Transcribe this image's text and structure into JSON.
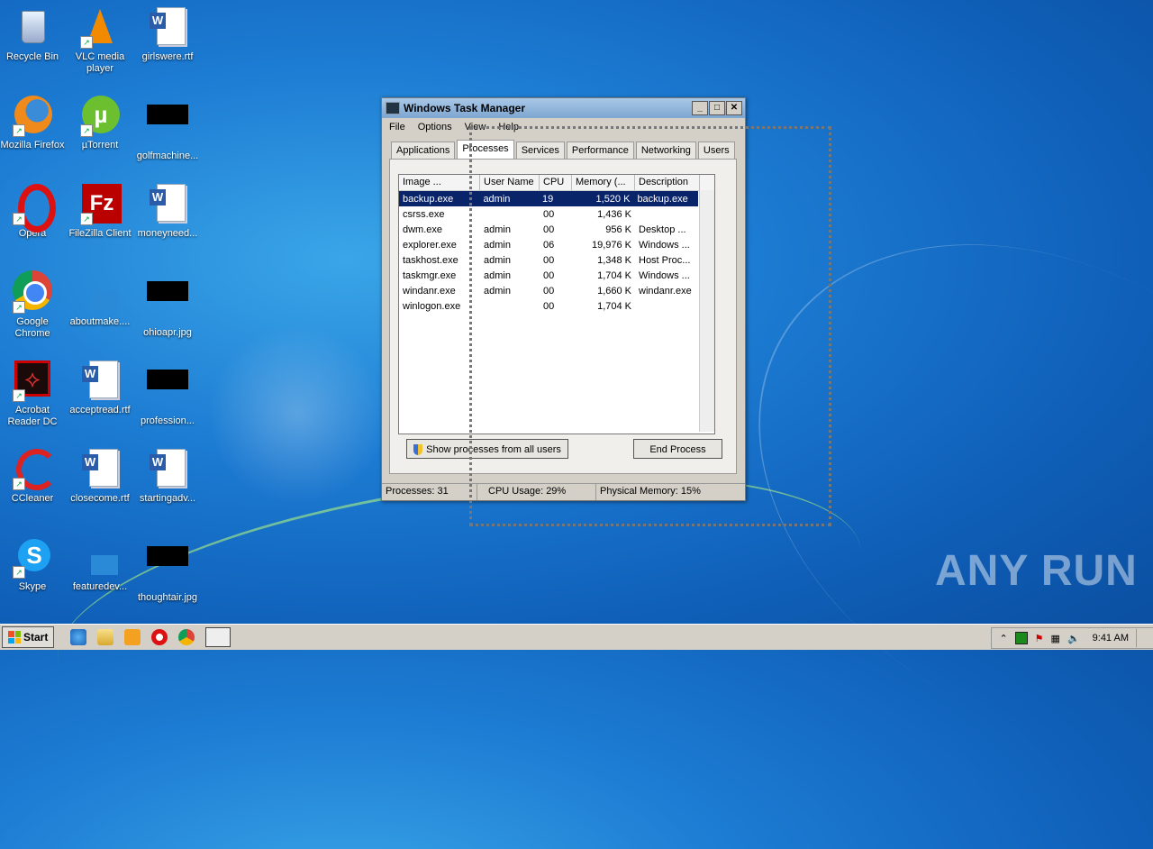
{
  "desktop": {
    "icons": [
      {
        "label": "Recycle Bin"
      },
      {
        "label": "VLC media player"
      },
      {
        "label": "girlswere.rtf"
      },
      {
        "label": "Mozilla Firefox"
      },
      {
        "label": "µTorrent"
      },
      {
        "label": "golfmachine..."
      },
      {
        "label": "Opera"
      },
      {
        "label": "FileZilla Client"
      },
      {
        "label": "moneyneed..."
      },
      {
        "label": "Google Chrome"
      },
      {
        "label": "aboutmake...."
      },
      {
        "label": "ohioapr.jpg"
      },
      {
        "label": "Acrobat Reader DC"
      },
      {
        "label": "acceptread.rtf"
      },
      {
        "label": "profession..."
      },
      {
        "label": "CCleaner"
      },
      {
        "label": "closecome.rtf"
      },
      {
        "label": "startingadv..."
      },
      {
        "label": "Skype"
      },
      {
        "label": "featuredev..."
      },
      {
        "label": "thoughtair.jpg"
      }
    ],
    "watermark": "ANY RUN"
  },
  "task_manager": {
    "title": "Windows Task Manager",
    "menu": [
      "File",
      "Options",
      "View",
      "Help"
    ],
    "tabs": [
      "Applications",
      "Processes",
      "Services",
      "Performance",
      "Networking",
      "Users"
    ],
    "active_tab": "Processes",
    "columns": [
      "Image ...",
      "User Name",
      "CPU",
      "Memory (...",
      "Description"
    ],
    "rows": [
      {
        "image": "backup.exe",
        "user": "admin",
        "cpu": "19",
        "memory": "1,520 K",
        "description": "backup.exe",
        "selected": true
      },
      {
        "image": "csrss.exe",
        "user": "",
        "cpu": "00",
        "memory": "1,436 K",
        "description": ""
      },
      {
        "image": "dwm.exe",
        "user": "admin",
        "cpu": "00",
        "memory": "956 K",
        "description": "Desktop ..."
      },
      {
        "image": "explorer.exe",
        "user": "admin",
        "cpu": "06",
        "memory": "19,976 K",
        "description": "Windows ..."
      },
      {
        "image": "taskhost.exe",
        "user": "admin",
        "cpu": "00",
        "memory": "1,348 K",
        "description": "Host Proc..."
      },
      {
        "image": "taskmgr.exe",
        "user": "admin",
        "cpu": "00",
        "memory": "1,704 K",
        "description": "Windows ..."
      },
      {
        "image": "windanr.exe",
        "user": "admin",
        "cpu": "00",
        "memory": "1,660 K",
        "description": "windanr.exe"
      },
      {
        "image": "winlogon.exe",
        "user": "",
        "cpu": "00",
        "memory": "1,704 K",
        "description": ""
      }
    ],
    "show_all_label": "Show processes from all users",
    "end_process_label": "End Process",
    "status": {
      "processes": "Processes: 31",
      "cpu": "CPU Usage: 29%",
      "memory": "Physical Memory: 15%"
    }
  },
  "taskbar": {
    "start_label": "Start",
    "clock": "9:41 AM"
  }
}
